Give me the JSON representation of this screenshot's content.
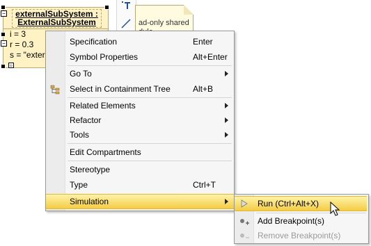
{
  "diagram": {
    "object": {
      "name_line1": "externalSubSystem :",
      "name_line2": "ExternalSubSystem",
      "attributes": [
        "i = 3",
        "r = 0.3",
        "s = \"exter"
      ]
    },
    "note": {
      "text_line1": "ad-only shared",
      "text_line2": "dule"
    },
    "toolbar": {
      "icon1": "text-tool-icon",
      "icon2": "line-tool-icon"
    }
  },
  "context_menu": {
    "items": [
      {
        "label": "Specification",
        "shortcut": "Enter"
      },
      {
        "label": "Symbol Properties",
        "shortcut": "Alt+Enter"
      },
      {
        "label": "Go To",
        "shortcut": ""
      },
      {
        "label": "Select in Containment Tree",
        "shortcut": "Alt+B",
        "icon": "containment-tree-icon"
      },
      {
        "label": "Related Elements",
        "shortcut": ""
      },
      {
        "label": "Refactor",
        "shortcut": ""
      },
      {
        "label": "Tools",
        "shortcut": ""
      },
      {
        "label": "Edit Compartments",
        "shortcut": ""
      },
      {
        "label": "Stereotype",
        "shortcut": ""
      },
      {
        "label": "Type",
        "shortcut": "Ctrl+T"
      },
      {
        "label": "Simulation",
        "shortcut": ""
      }
    ]
  },
  "simulation_submenu": {
    "items": [
      {
        "label": "Run (Ctrl+Alt+X)",
        "icon": "run-icon"
      },
      {
        "label": "Add Breakpoint(s)",
        "icon": "add-breakpoint-icon"
      },
      {
        "label": "Remove Breakpoint(s)",
        "icon": "remove-breakpoint-icon",
        "disabled": true
      }
    ]
  },
  "colors": {
    "highlight_top": "#fff3a8",
    "highlight_bottom": "#f3cc45",
    "object_fill": "#fff2c4"
  }
}
